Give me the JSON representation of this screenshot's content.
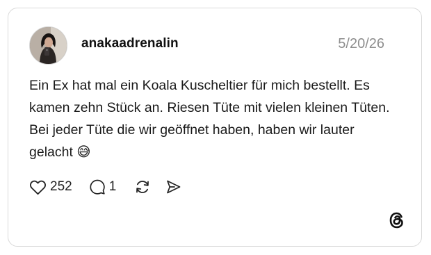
{
  "post": {
    "username": "anakaadrenalin",
    "date": "5/20/26",
    "text": "Ein Ex hat mal ein Koala Kuscheltier für mich bestellt. Es kamen zehn Stück an. Riesen Tüte mit vielen kleinen Tüten. Bei jeder Tüte die wir geöffnet haben, haben wir lauter gelacht 😅",
    "likes": "252",
    "replies": "1"
  },
  "icons": {
    "like": "heart-icon",
    "reply": "comment-icon",
    "repost": "repost-icon",
    "share": "share-icon",
    "brand": "threads-logo-icon"
  },
  "colors": {
    "text": "#1a1a1a",
    "muted": "#8e8e8e",
    "border": "#d9d9d9"
  }
}
